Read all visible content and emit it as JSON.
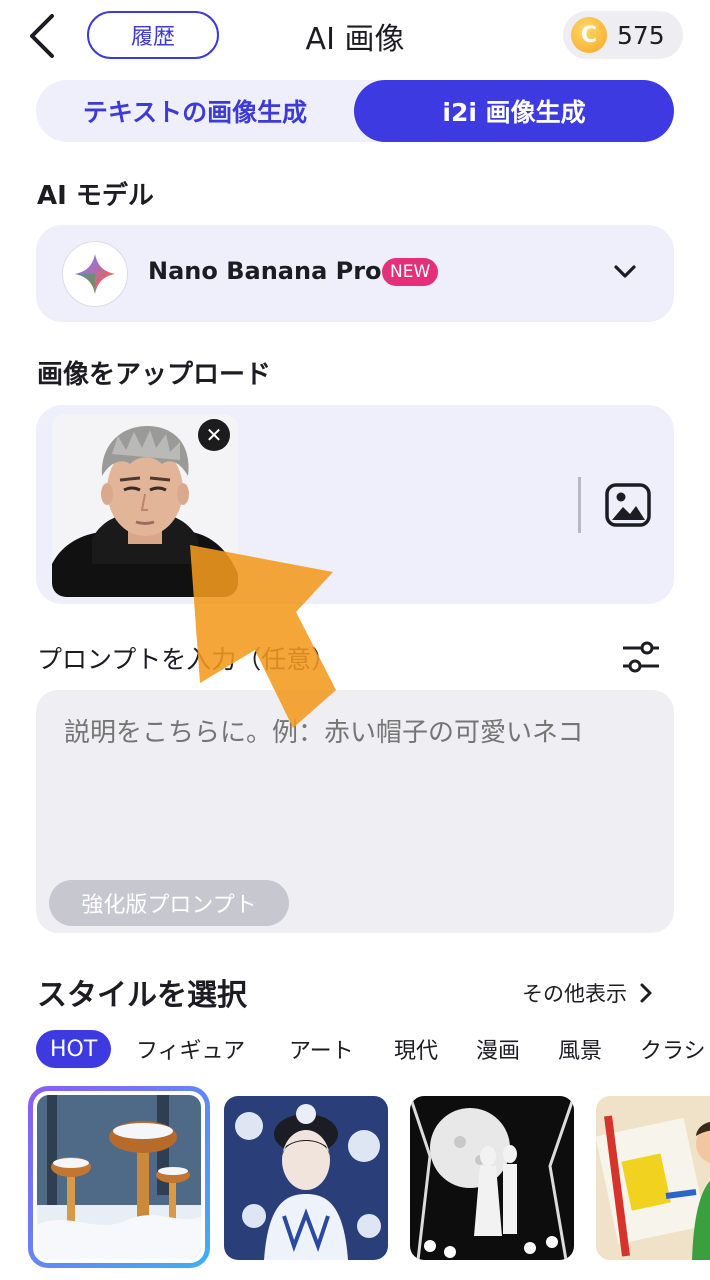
{
  "header": {
    "history_label": "履歴",
    "title": "AI 画像",
    "coin_symbol": "C",
    "coin_count": "575"
  },
  "mode_tabs": [
    {
      "label": "テキストの画像生成",
      "selected": false
    },
    {
      "label": "i2i 画像生成",
      "selected": true
    }
  ],
  "model_section": {
    "label": "AI モデル",
    "model_name": "Nano Banana Pro",
    "badge": "NEW"
  },
  "upload_section": {
    "label": "画像をアップロード",
    "remove_symbol": "✕"
  },
  "prompt_section": {
    "label": "プロンプトを入力（任意）",
    "placeholder": "説明をこちらに。例：赤い帽子の可愛いネコ",
    "enhance_label": "強化版プロンプト"
  },
  "style_section": {
    "label": "スタイルを選択",
    "more_label": "その他表示",
    "categories": [
      {
        "label": "HOT",
        "active": true
      },
      {
        "label": "フィギュア",
        "active": false
      },
      {
        "label": "アート",
        "active": false
      },
      {
        "label": "現代",
        "active": false
      },
      {
        "label": "漫画",
        "active": false
      },
      {
        "label": "風景",
        "active": false
      },
      {
        "label": "クラシ",
        "active": false
      }
    ],
    "cards": [
      {
        "name": "mushroom-snow",
        "selected": true
      },
      {
        "name": "blue-porcelain-woman",
        "selected": false
      },
      {
        "name": "moon-couple-lineart",
        "selected": false
      },
      {
        "name": "child-painting",
        "selected": false
      }
    ]
  },
  "colors": {
    "accent": "#3c3ae0",
    "badge": "#e4307a",
    "panel": "#efeffb",
    "arrow": "#f39a1e"
  }
}
